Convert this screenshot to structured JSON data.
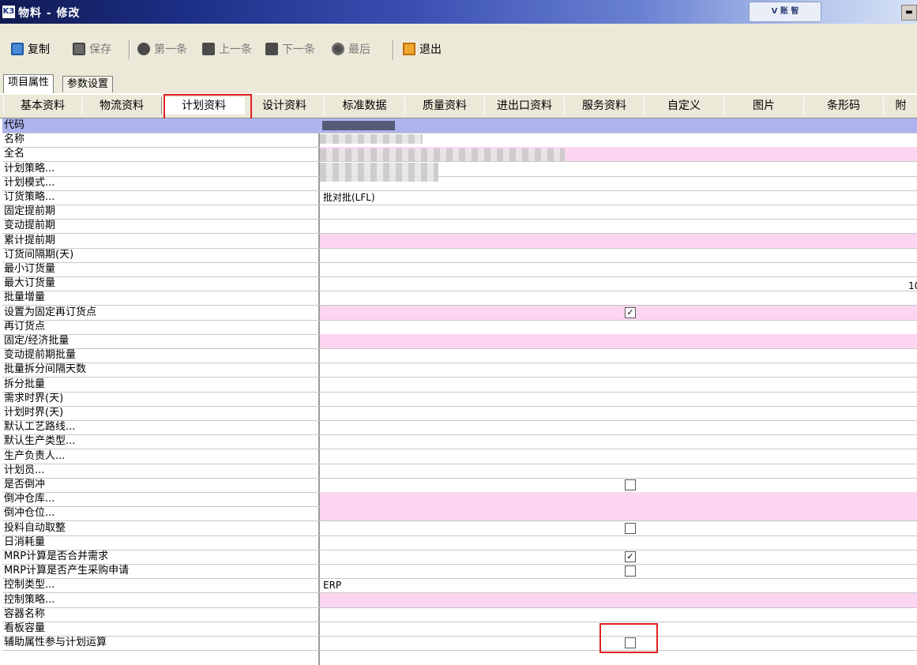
{
  "window": {
    "title": "物料 - 修改",
    "app_icon": "K3",
    "brand_badge": "V 账 智"
  },
  "toolbar": {
    "copy_label": "复制",
    "save_label": "保存",
    "first_label": "第一条",
    "prev_label": "上一条",
    "next_label": "下一条",
    "last_label": "最后",
    "exit_label": "退出"
  },
  "outer_tabs": [
    "项目属性",
    "参数设置"
  ],
  "inner_tabs": [
    "基本资料",
    "物流资料",
    "计划资料",
    "设计资料",
    "标准数据",
    "质量资料",
    "进出口资料",
    "服务资料",
    "自定义",
    "图片",
    "条形码",
    "附"
  ],
  "side_value": "10",
  "rows": [
    {
      "label": "代码",
      "value": "",
      "kind": "header"
    },
    {
      "label": "名称",
      "value": "",
      "kind": "plain"
    },
    {
      "label": "全名",
      "value": "",
      "kind": "pink"
    },
    {
      "label": "计划策略...",
      "value": "",
      "kind": "plain"
    },
    {
      "label": "计划模式...",
      "value": "",
      "kind": "plain"
    },
    {
      "label": "订货策略...",
      "value": "批对批(LFL)",
      "kind": "plain"
    },
    {
      "label": "固定提前期",
      "value": "",
      "kind": "plain"
    },
    {
      "label": "变动提前期",
      "value": "",
      "kind": "plain"
    },
    {
      "label": "累计提前期",
      "value": "",
      "kind": "pink"
    },
    {
      "label": "订货间隔期(天)",
      "value": "",
      "kind": "plain"
    },
    {
      "label": "最小订货量",
      "value": "",
      "kind": "plain"
    },
    {
      "label": "最大订货量",
      "value": "",
      "kind": "plain"
    },
    {
      "label": "批量增量",
      "value": "",
      "kind": "plain"
    },
    {
      "label": "设置为固定再订货点",
      "value": "",
      "kind": "pink",
      "checkbox": true,
      "checked": true
    },
    {
      "label": "再订货点",
      "value": "",
      "kind": "plain"
    },
    {
      "label": "固定/经济批量",
      "value": "",
      "kind": "pink"
    },
    {
      "label": "变动提前期批量",
      "value": "",
      "kind": "plain"
    },
    {
      "label": "批量拆分间隔天数",
      "value": "",
      "kind": "plain"
    },
    {
      "label": "拆分批量",
      "value": "",
      "kind": "plain"
    },
    {
      "label": "需求时界(天)",
      "value": "",
      "kind": "plain"
    },
    {
      "label": "计划时界(天)",
      "value": "",
      "kind": "plain"
    },
    {
      "label": "默认工艺路线...",
      "value": "",
      "kind": "plain"
    },
    {
      "label": "默认生产类型...",
      "value": "",
      "kind": "plain"
    },
    {
      "label": "生产负责人...",
      "value": "",
      "kind": "plain"
    },
    {
      "label": "计划员...",
      "value": "",
      "kind": "plain"
    },
    {
      "label": "是否倒冲",
      "value": "",
      "kind": "plain",
      "checkbox": true,
      "checked": false
    },
    {
      "label": "倒冲仓库...",
      "value": "",
      "kind": "pink"
    },
    {
      "label": "倒冲仓位...",
      "value": "",
      "kind": "pink"
    },
    {
      "label": "投料自动取整",
      "value": "",
      "kind": "plain",
      "checkbox": true,
      "checked": false
    },
    {
      "label": "日消耗量",
      "value": "",
      "kind": "plain"
    },
    {
      "label": "MRP计算是否合并需求",
      "value": "",
      "kind": "plain",
      "checkbox": true,
      "checked": true
    },
    {
      "label": "MRP计算是否产生采购申请",
      "value": "",
      "kind": "plain",
      "checkbox": true,
      "checked": false
    },
    {
      "label": "控制类型...",
      "value": "ERP",
      "kind": "plain"
    },
    {
      "label": "控制策略...",
      "value": "",
      "kind": "pink"
    },
    {
      "label": "容器名称",
      "value": "",
      "kind": "plain"
    },
    {
      "label": "看板容量",
      "value": "",
      "kind": "plain"
    },
    {
      "label": "辅助属性参与计划运算",
      "value": "",
      "kind": "plain",
      "checkbox": true,
      "checked": false
    }
  ],
  "colors": {
    "pink_cell": "#fcd6f0",
    "header_row": "#aeb3ee",
    "highlight": "#e02020"
  }
}
